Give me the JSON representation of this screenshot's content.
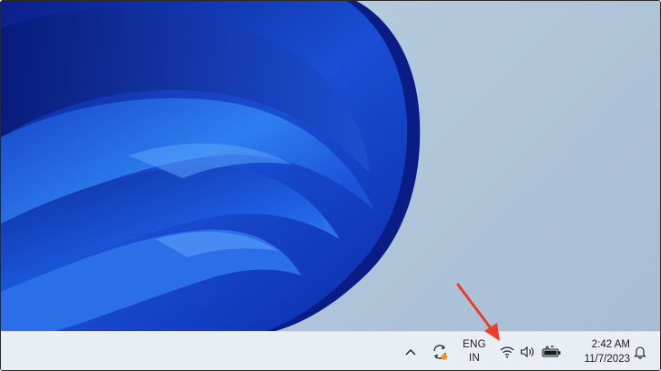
{
  "taskbar": {
    "language": {
      "line1": "ENG",
      "line2": "IN"
    },
    "clock": {
      "time": "2:42 AM",
      "date": "11/7/2023"
    }
  },
  "icons": {
    "chevron": "chevron-up-icon",
    "sync": "sync-icon",
    "wifi": "wifi-icon",
    "volume": "volume-icon",
    "battery": "battery-icon",
    "bell": "bell-icon"
  },
  "colors": {
    "annotation_arrow": "#e8402a",
    "sync_badge": "#f7930f",
    "wallpaper_blue": "#1e54d6"
  }
}
